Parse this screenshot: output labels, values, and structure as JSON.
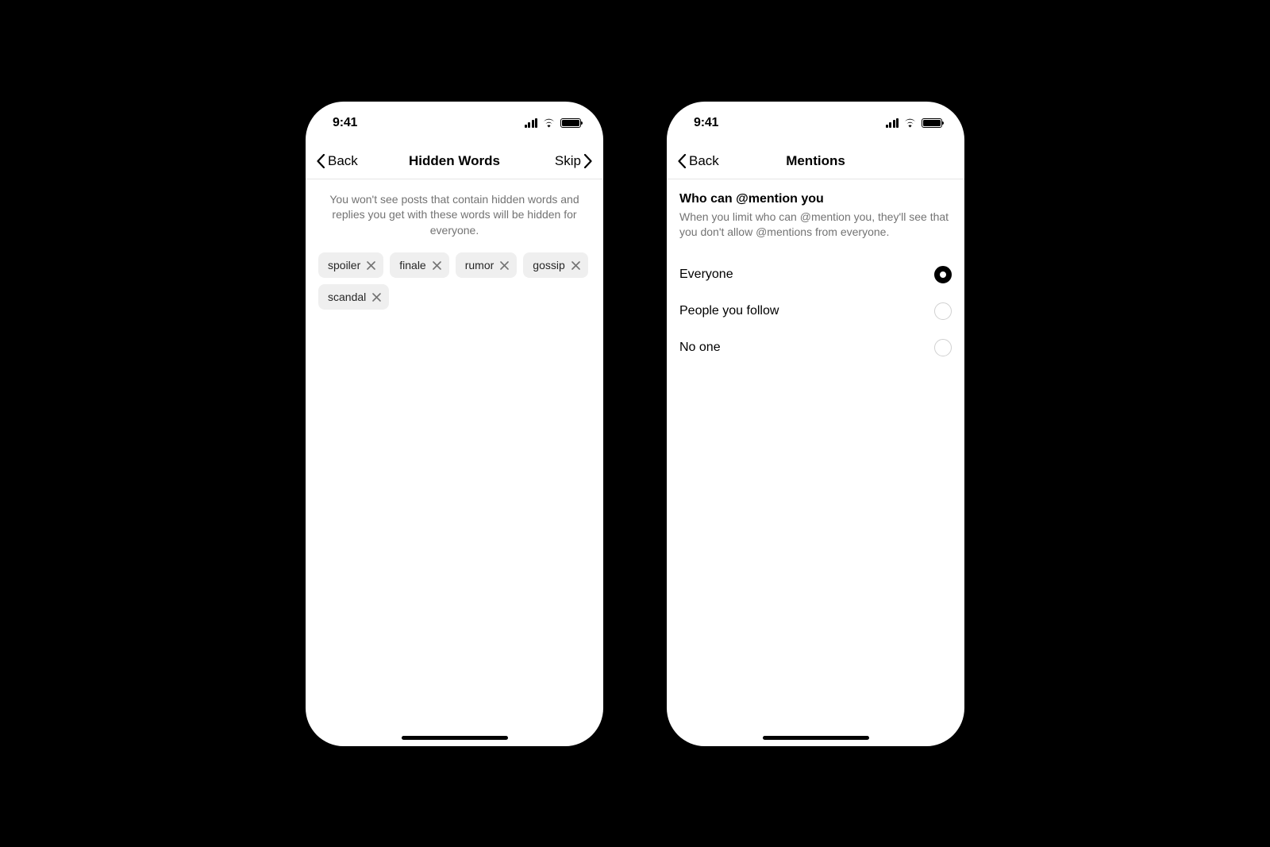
{
  "status_bar": {
    "time": "9:41"
  },
  "left_screen": {
    "nav": {
      "back_label": "Back",
      "title": "Hidden Words",
      "skip_label": "Skip"
    },
    "description": "You won't see posts that contain hidden words and replies you get with these words will be hidden for everyone.",
    "chips": [
      {
        "label": "spoiler"
      },
      {
        "label": "finale"
      },
      {
        "label": "rumor"
      },
      {
        "label": "gossip"
      },
      {
        "label": "scandal"
      }
    ]
  },
  "right_screen": {
    "nav": {
      "back_label": "Back",
      "title": "Mentions"
    },
    "section_title": "Who can @mention you",
    "section_desc": "When you limit who can @mention you, they'll see that you don't allow @mentions from everyone.",
    "options": [
      {
        "label": "Everyone",
        "selected": true
      },
      {
        "label": "People you follow",
        "selected": false
      },
      {
        "label": "No one",
        "selected": false
      }
    ]
  }
}
